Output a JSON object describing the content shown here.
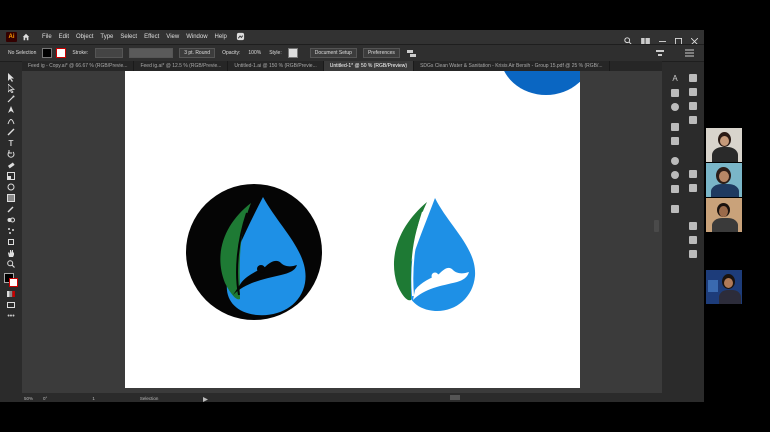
{
  "menu": {
    "logo": "Ai",
    "items": [
      "File",
      "Edit",
      "Object",
      "Type",
      "Select",
      "Effect",
      "View",
      "Window",
      "Help"
    ]
  },
  "control_bar": {
    "selection": "No Selection",
    "stroke_label": "Stroke:",
    "brush_value": "3 pt. Round",
    "opacity_label": "Opacity:",
    "opacity_value": "100%",
    "style_label": "Style:",
    "document_setup": "Document Setup",
    "preferences": "Preferences"
  },
  "tabs": [
    {
      "label": "Feed ig - Copy.ai* @ 66.67 % (RGB/Previe...",
      "active": false
    },
    {
      "label": "Feed ig.ai* @ 12.5 % (RGB/Previe...",
      "active": false
    },
    {
      "label": "Untitled-1.ai @ 150 % (RGB/Previe...",
      "active": false
    },
    {
      "label": "Untitled-1* @ 50 % (RGB/Preview)",
      "active": true
    },
    {
      "label": "SDGs Clean Water & Sanitation - Krisis Air Bersih - Group 15.pdf @ 25 % (RGB/...",
      "active": false
    }
  ],
  "status": {
    "zoom": "50%",
    "rotation": "0°",
    "artboard": "1",
    "tool": "Selection"
  },
  "colors": {
    "water_blue": "#1e90e6",
    "leaf_green": "#1e7a34",
    "badge_black": "#050505",
    "accent_blue": "#0a66c2"
  }
}
